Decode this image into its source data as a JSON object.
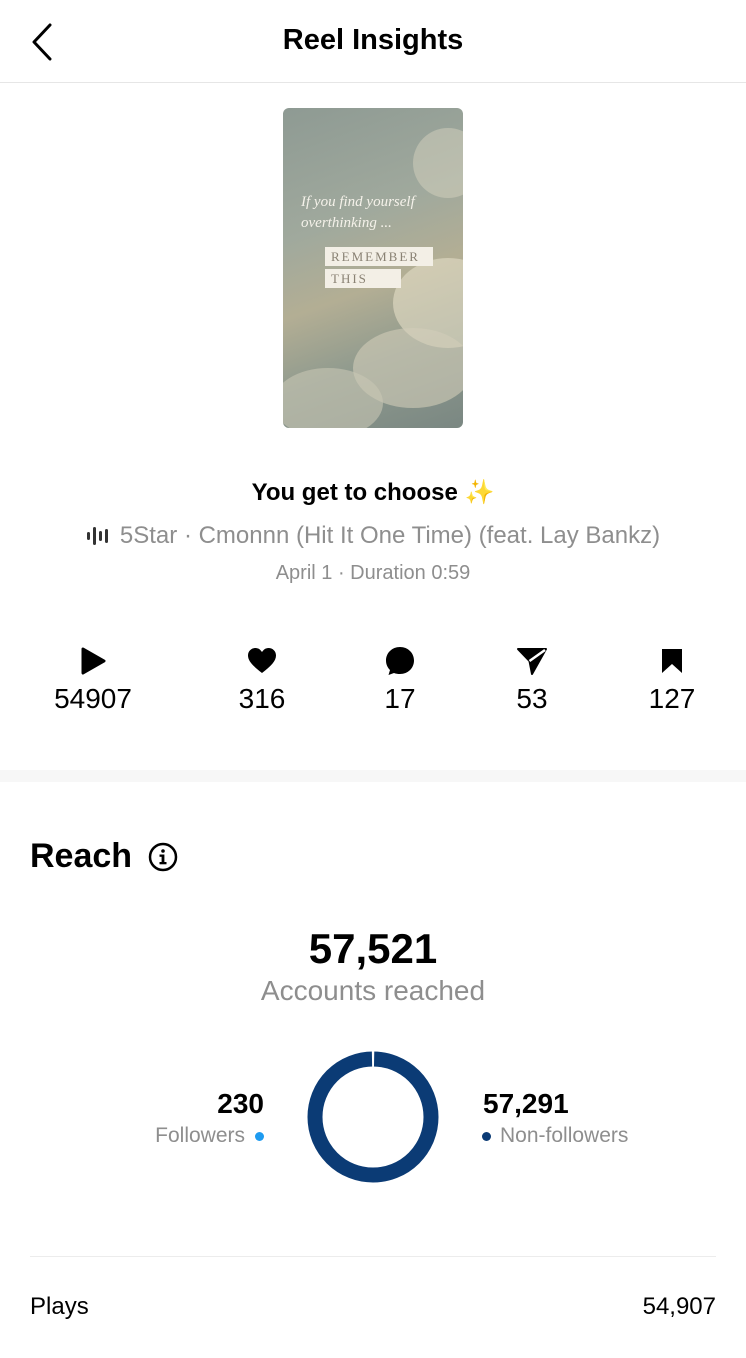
{
  "header": {
    "title": "Reel Insights"
  },
  "reel": {
    "thumb_line1": "If you find yourself",
    "thumb_line2": "overthinking ...",
    "thumb_tag1": "REMEMBER",
    "thumb_tag2": "THIS",
    "caption": "You get to choose",
    "caption_emoji": "✨",
    "music": "5Star · Cmonnn (Hit It One Time) (feat. Lay Bankz)",
    "meta": "April 1 · Duration 0:59"
  },
  "stats": {
    "plays": "54907",
    "likes": "316",
    "comments": "17",
    "shares": "53",
    "saves": "127"
  },
  "reach": {
    "title": "Reach",
    "accounts_reached": "57,521",
    "accounts_label": "Accounts reached",
    "followers": "230",
    "followers_label": "Followers",
    "non_followers": "57,291",
    "non_followers_label": "Non-followers",
    "followers_share": 0.004,
    "colors": {
      "followers": "#1e9bf0",
      "non_followers": "#0b3b75"
    }
  },
  "rows": {
    "plays_label": "Plays",
    "plays_value": "54,907"
  }
}
